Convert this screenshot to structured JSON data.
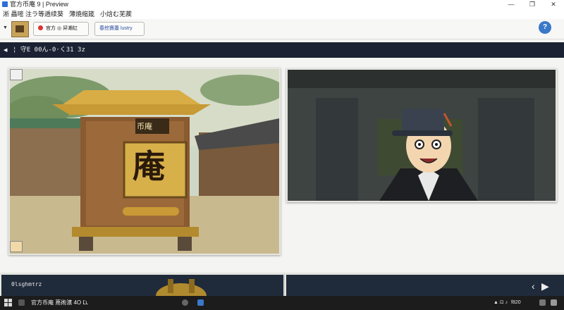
{
  "window": {
    "title": "官方币庵 9   | Preview",
    "minimize_glyph": "—",
    "maximize_glyph": "❐",
    "close_glyph": "✕"
  },
  "menu": {
    "items": [
      "淅 蟲嘧",
      "注ラ等逓续葵",
      "薄焼缩箴",
      "小焓む芜蒺"
    ]
  },
  "toolbar": {
    "collapse_glyph": "▼",
    "location_label": "官方 ◎ 舁濑缸",
    "history_label": "春挖賽蕭 lustry",
    "help_glyph": "?"
  },
  "chapter": {
    "expand_glyph": "◀",
    "label": "¦ 守E 00ん-0·く31  3z"
  },
  "panels": {
    "panel1": {
      "sign_label": "币庵",
      "sign_big": "庵"
    },
    "panel3": {
      "caption": "θlsghmτrz"
    },
    "prev_glyph": "‹",
    "next_glyph": "▶"
  },
  "taskbar": {
    "task_label": "官方币庵  蔦術濱 4О Ľʟ",
    "tray_label": "f820",
    "tray_glyphs": "▲ ⊡ ♪"
  },
  "colors": {
    "chapter_strip": "#1a2233",
    "panel_border": "#e6e6e0",
    "taskbar": "#1c1c1c",
    "accent_blue": "#3a78c8"
  }
}
